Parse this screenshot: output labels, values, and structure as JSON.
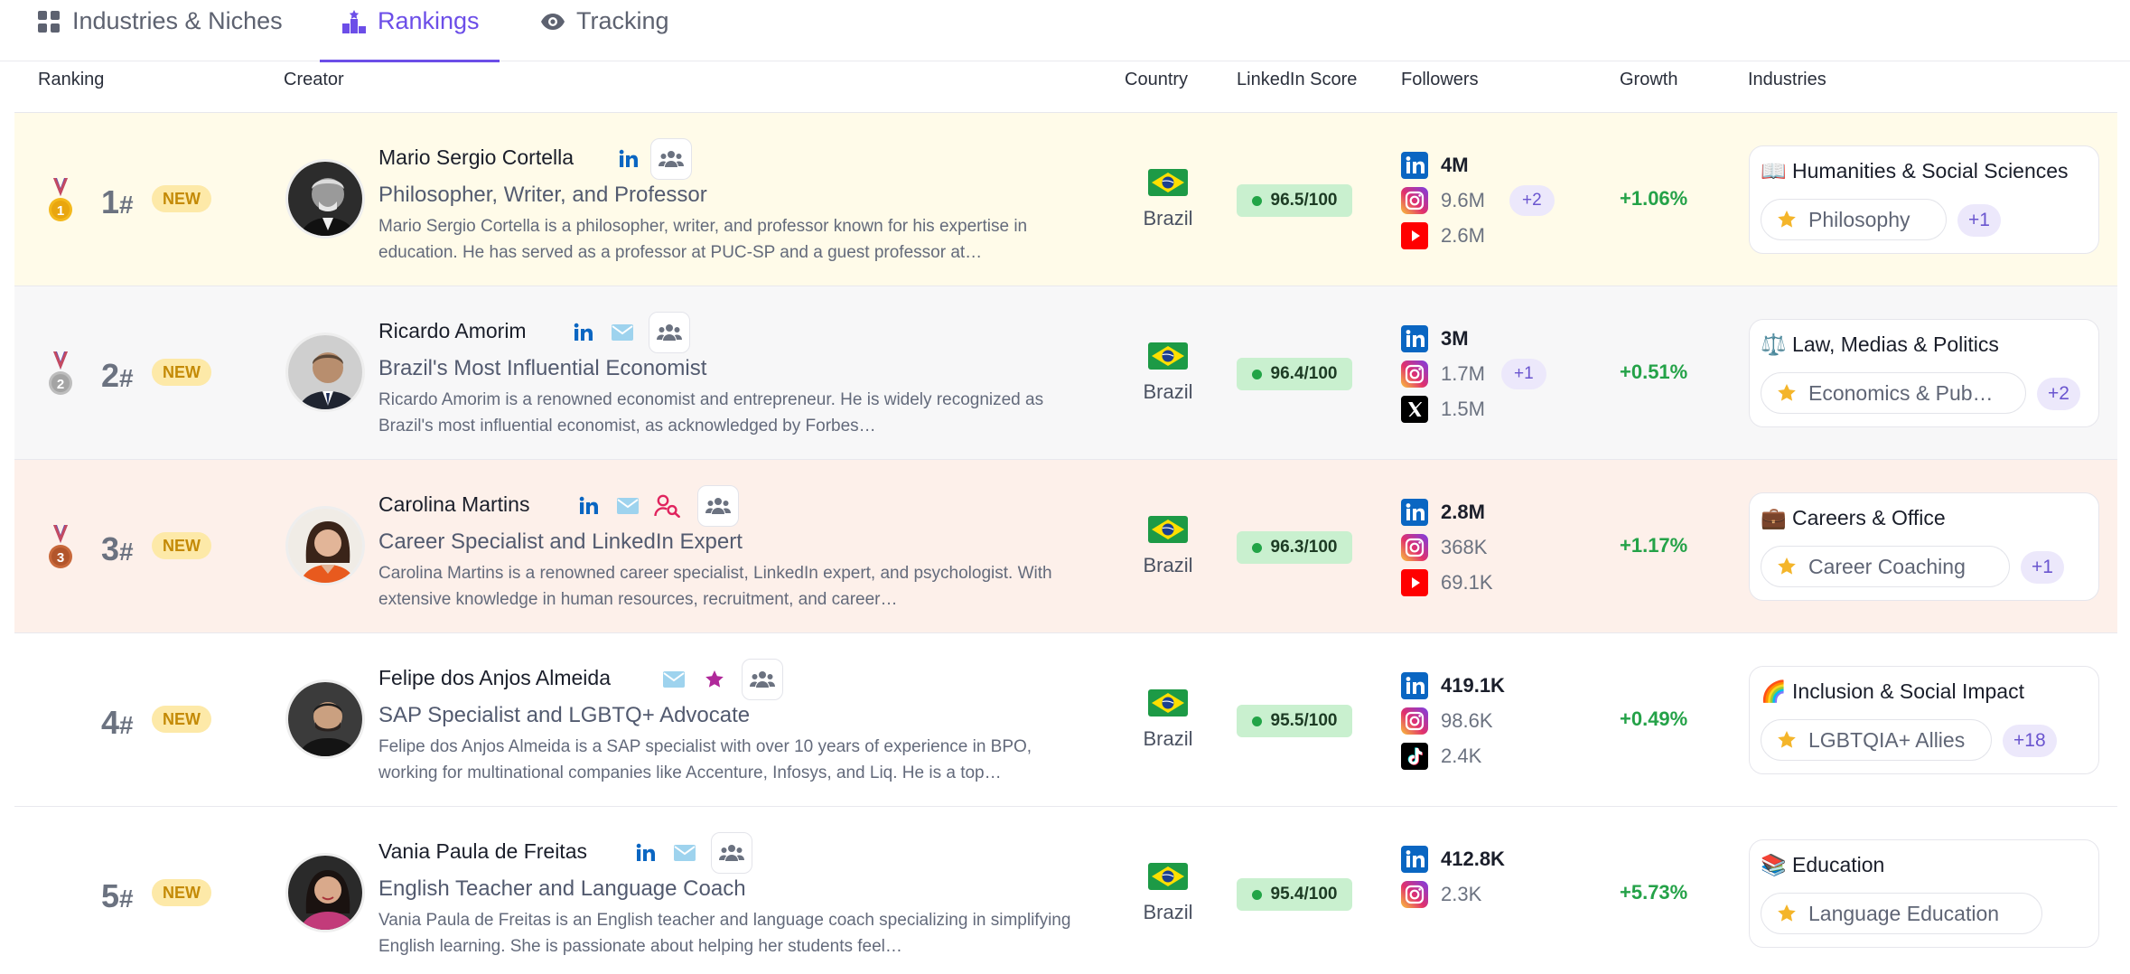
{
  "tabs": [
    {
      "label": "Industries & Niches",
      "icon": "grid-icon",
      "active": false
    },
    {
      "label": "Rankings",
      "icon": "podium-icon",
      "active": true
    },
    {
      "label": "Tracking",
      "icon": "eye-icon",
      "active": false
    }
  ],
  "columns": {
    "ranking": "Ranking",
    "creator": "Creator",
    "country": "Country",
    "score": "LinkedIn Score",
    "followers": "Followers",
    "growth": "Growth",
    "industries": "Industries"
  },
  "colors": {
    "accent": "#6c4ee8",
    "growth": "#24a248",
    "score_bg": "#c9f0cf",
    "new_badge": "#fde9a8"
  },
  "rows": [
    {
      "rank": "1",
      "hash": "#",
      "medal": "gold-medal-icon",
      "badge": "NEW",
      "name": "Mario Sergio Cortella",
      "title": "Philosopher, Writer, and Professor",
      "description": "Mario Sergio Cortella is a philosopher, writer, and professor known for his expertise in education. He has served as a professor at PUC-SP and a guest professor at…",
      "country": "Brazil",
      "score": "96.5/100",
      "followers": [
        {
          "platform": "linkedin-icon",
          "count": "4M"
        },
        {
          "platform": "instagram-icon",
          "count": "9.6M"
        },
        {
          "platform": "youtube-icon",
          "count": "2.6M"
        }
      ],
      "followers_more": "+2",
      "growth": "+1.06%",
      "industry_icon": "📖",
      "industry": "Humanities & Social Sciences",
      "niche": "Philosophy",
      "niche_more": "+1"
    },
    {
      "rank": "2",
      "hash": "#",
      "medal": "silver-medal-icon",
      "badge": "NEW",
      "name": "Ricardo Amorim",
      "title": "Brazil's Most Influential Economist",
      "description": "Ricardo Amorim is a renowned economist and entrepreneur. He is widely recognized as Brazil's most influential economist, as acknowledged by Forbes…",
      "country": "Brazil",
      "score": "96.4/100",
      "followers": [
        {
          "platform": "linkedin-icon",
          "count": "3M"
        },
        {
          "platform": "instagram-icon",
          "count": "1.7M"
        },
        {
          "platform": "x-icon",
          "count": "1.5M"
        }
      ],
      "followers_more": "+1",
      "growth": "+0.51%",
      "industry_icon": "⚖️",
      "industry": "Law, Medias & Politics",
      "niche": "Economics & Pub…",
      "niche_more": "+2"
    },
    {
      "rank": "3",
      "hash": "#",
      "medal": "bronze-medal-icon",
      "badge": "NEW",
      "name": "Carolina Martins",
      "title": "Career Specialist and LinkedIn Expert",
      "description": "Carolina Martins is a renowned career specialist, LinkedIn expert, and psychologist. With extensive knowledge in human resources, recruitment, and career…",
      "country": "Brazil",
      "score": "96.3/100",
      "followers": [
        {
          "platform": "linkedin-icon",
          "count": "2.8M"
        },
        {
          "platform": "instagram-icon",
          "count": "368K"
        },
        {
          "platform": "youtube-icon",
          "count": "69.1K"
        }
      ],
      "followers_more": "",
      "growth": "+1.17%",
      "industry_icon": "💼",
      "industry": "Careers & Office",
      "niche": "Career Coaching",
      "niche_more": "+1"
    },
    {
      "rank": "4",
      "hash": "#",
      "medal": "",
      "badge": "NEW",
      "name": "Felipe dos Anjos Almeida",
      "title": "SAP Specialist and LGBTQ+ Advocate",
      "description": "Felipe dos Anjos Almeida is a SAP specialist with over 10 years of experience in BPO, working for multinational companies like Accenture, Infosys, and Liq. He is a top…",
      "country": "Brazil",
      "score": "95.5/100",
      "followers": [
        {
          "platform": "linkedin-icon",
          "count": "419.1K"
        },
        {
          "platform": "instagram-icon",
          "count": "98.6K"
        },
        {
          "platform": "tiktok-icon",
          "count": "2.4K"
        }
      ],
      "followers_more": "",
      "growth": "+0.49%",
      "industry_icon": "🌈",
      "industry": "Inclusion & Social Impact",
      "niche": "LGBTQIA+ Allies",
      "niche_more": "+18"
    },
    {
      "rank": "5",
      "hash": "#",
      "medal": "",
      "badge": "NEW",
      "name": "Vania Paula de Freitas",
      "title": "English Teacher and Language Coach",
      "description": "Vania Paula de Freitas is an English teacher and language coach specializing in simplifying English learning. She is passionate about helping her students feel…",
      "country": "Brazil",
      "score": "95.4/100",
      "followers": [
        {
          "platform": "linkedin-icon",
          "count": "412.8K"
        },
        {
          "platform": "instagram-icon",
          "count": "2.3K"
        }
      ],
      "followers_more": "",
      "growth": "+5.73%",
      "industry_icon": "📚",
      "industry": "Education",
      "niche": "Language Education",
      "niche_more": ""
    }
  ]
}
